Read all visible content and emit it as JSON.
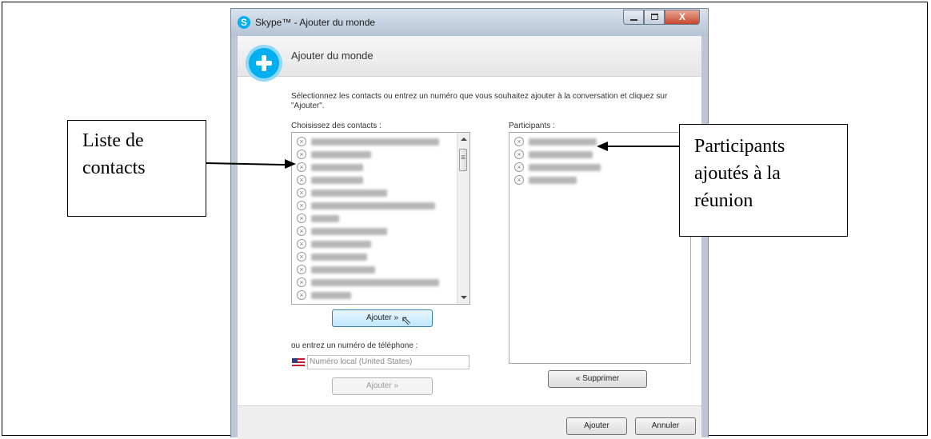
{
  "window": {
    "title": "Skype™ - Ajouter du monde",
    "logo_glyph": "S",
    "close_glyph": "X"
  },
  "header": {
    "heading": "Ajouter du monde",
    "icon": "add-plus-icon"
  },
  "instruction": "Sélectionnez les contacts ou entrez un numéro que vous souhaitez ajouter à la conversation et cliquez sur \"Ajouter\".",
  "contacts": {
    "label": "Choisissez des contacts :",
    "row_count": 13
  },
  "participants": {
    "label": "Participants :",
    "row_count": 4
  },
  "buttons": {
    "add_contacts": "Ajouter »",
    "add_phone": "Ajouter »",
    "remove": "« Supprimer",
    "ok": "Ajouter",
    "cancel": "Annuler"
  },
  "phone": {
    "label": "ou entrez un numéro de téléphone :",
    "placeholder": "Numéro local (United States)"
  },
  "callouts": {
    "contacts": "Liste de contacts",
    "participants": "Participants ajoutés à la réunion"
  },
  "colors": {
    "skype_blue": "#00aff0",
    "primary_button": "#bee6fd"
  }
}
